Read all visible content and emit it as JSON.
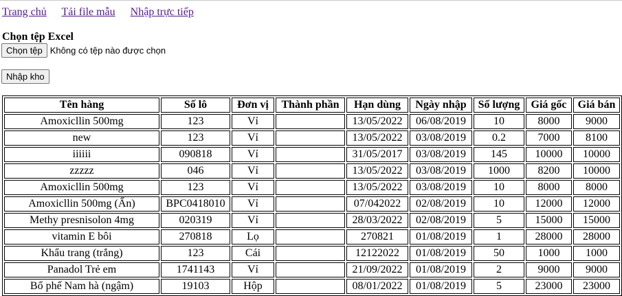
{
  "nav": {
    "home": "Trang chủ",
    "download_template": "Tải file mẫu",
    "direct_entry": "Nhập trực tiếp"
  },
  "upload": {
    "title": "Chọn tệp Excel",
    "choose_button": "Chọn tệp",
    "no_file_text": "Không có tệp nào được chọn"
  },
  "import_button": "Nhập kho",
  "table": {
    "headers": [
      "Tên hàng",
      "Số lô",
      "Đơn vị",
      "Thành phần",
      "Hạn dùng",
      "Ngày nhập",
      "Số lượng",
      "Giá gốc",
      "Giá bán"
    ],
    "rows": [
      [
        "Amoxicllin 500mg",
        "123",
        "Vỉ",
        "",
        "13/05/2022",
        "06/08/2019",
        "10",
        "8000",
        "9000"
      ],
      [
        "new",
        "123",
        "Vỉ",
        "",
        "13/05/2022",
        "03/08/2019",
        "0.2",
        "7000",
        "8100"
      ],
      [
        "iiiiii",
        "090818",
        "Vỉ",
        "",
        "31/05/2017",
        "03/08/2019",
        "145",
        "10000",
        "10000"
      ],
      [
        "zzzzz",
        "046",
        "Vỉ",
        "",
        "13/05/2022",
        "03/08/2019",
        "1000",
        "8200",
        "10000"
      ],
      [
        "Amoxicllin 500mg",
        "123",
        "Vỉ",
        "",
        "13/05/2022",
        "03/08/2019",
        "10",
        "8000",
        "8000"
      ],
      [
        "Amoxicllin 500mg (Ấn)",
        "BPC0418010",
        "Vỉ",
        "",
        "07/042022",
        "02/08/2019",
        "10",
        "12000",
        "12000"
      ],
      [
        "Methy presnisolon 4mg",
        "020319",
        "Vỉ",
        "",
        "28/03/2022",
        "02/08/2019",
        "5",
        "15000",
        "15000"
      ],
      [
        "vitamin E bôi",
        "270818",
        "Lọ",
        "",
        "270821",
        "01/08/2019",
        "1",
        "28000",
        "28000"
      ],
      [
        "Khẩu trang (trắng)",
        "123",
        "Cái",
        "",
        "12122022",
        "01/08/2019",
        "50",
        "1000",
        "1000"
      ],
      [
        "Panadol Trẻ em",
        "1741143",
        "Vỉ",
        "",
        "21/09/2022",
        "01/08/2019",
        "2",
        "9000",
        "9000"
      ],
      [
        "Bổ phế Nam hà (ngậm)",
        "19103",
        "Hộp",
        "",
        "08/01/2022",
        "01/08/2019",
        "5",
        "23000",
        "23000"
      ]
    ]
  }
}
